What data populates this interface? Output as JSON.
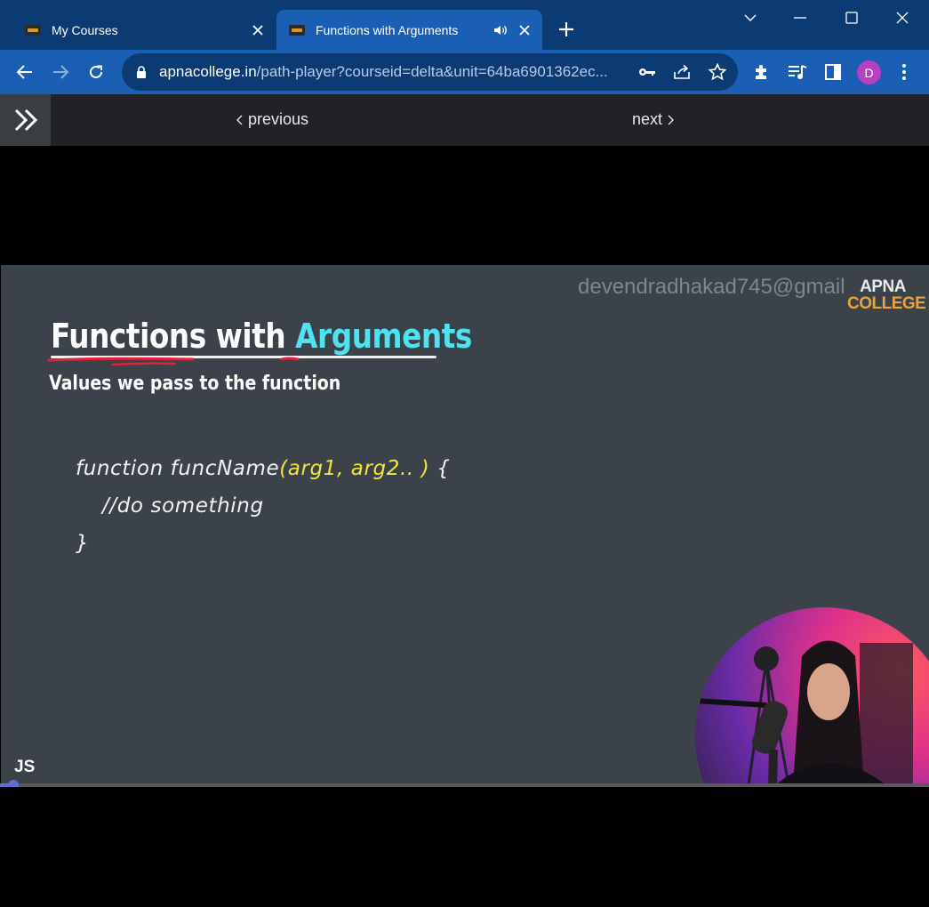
{
  "browser": {
    "tabs": [
      {
        "title": "My Courses",
        "active": false
      },
      {
        "title": "Functions with Arguments",
        "active": true,
        "audio": true
      }
    ],
    "url_host": "apnacollege.in",
    "url_rest": "/path-player?courseid=delta&unit=64ba6901362ec...",
    "profile_initial": "D",
    "colors": {
      "titlebar": "#0c3a73",
      "toolbar": "#1a5fb4",
      "avatar": "#b540c4"
    }
  },
  "pagenav": {
    "previous": "previous",
    "next": "next"
  },
  "slide": {
    "watermark": "devendradhakad745@gmail",
    "logo_top": "APNA",
    "logo_bottom": "COLLEGE",
    "title_main": "Functions with ",
    "title_accent": "Arguments",
    "subtitle": "Values we pass to the function",
    "code_line1_a": "function funcName",
    "code_line1_b": "(arg1, arg2.. )",
    "code_line1_c": " {",
    "code_line2": "//do something",
    "code_line3": "}",
    "badge": "JS"
  },
  "player": {
    "progress_fraction": 0.014
  }
}
